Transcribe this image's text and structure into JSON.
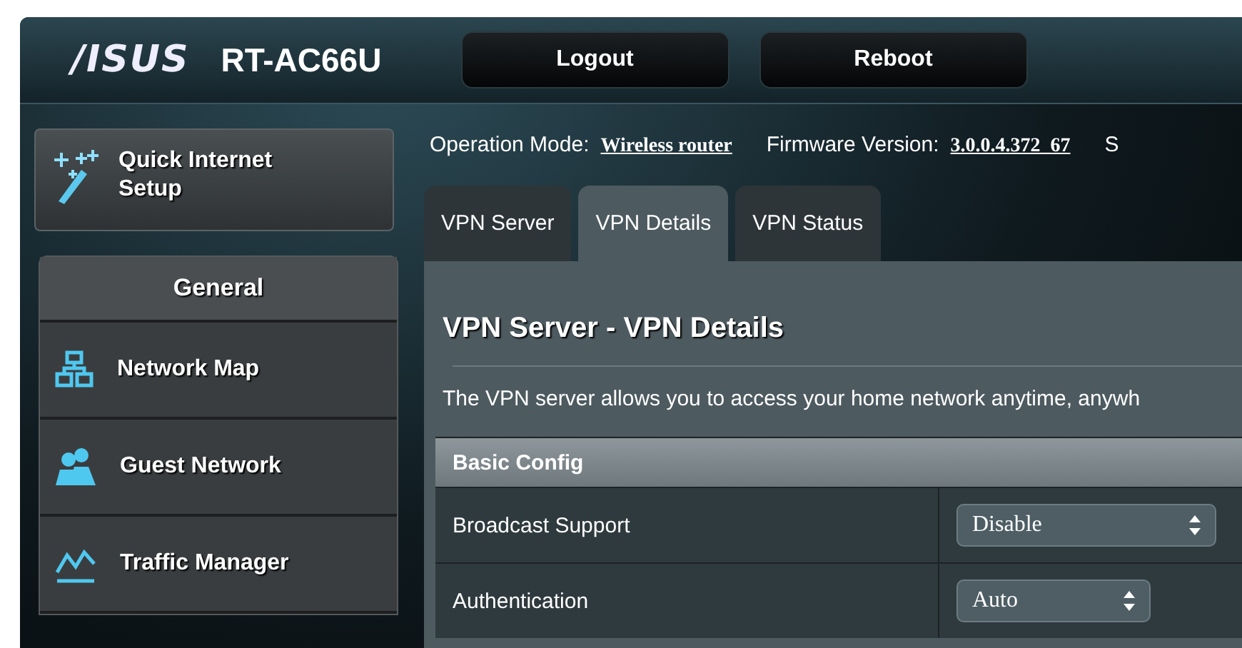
{
  "header": {
    "brand": "/ISUS",
    "model": "RT-AC66U",
    "buttons": [
      "Logout",
      "Reboot"
    ]
  },
  "quick_setup": {
    "label": "Quick Internet Setup"
  },
  "sidebar": {
    "title": "General",
    "items": [
      {
        "label": "Network Map"
      },
      {
        "label": "Guest Network"
      },
      {
        "label": "Traffic Manager"
      }
    ]
  },
  "status_line": [
    {
      "label": "Operation Mode:",
      "value": "Wireless router"
    },
    {
      "label": "Firmware Version:",
      "value": "3.0.0.4.372_67"
    },
    {
      "label": "S"
    }
  ],
  "tabs": [
    {
      "label": "VPN Server",
      "selected": false
    },
    {
      "label": "VPN Details",
      "selected": true
    },
    {
      "label": "VPN Status",
      "selected": false
    }
  ],
  "page": {
    "title": "VPN Server - VPN Details",
    "description": "The VPN server allows you to access your home network anytime, anywh"
  },
  "config": {
    "title": "Basic Config",
    "rows": [
      {
        "label": "Broadcast Support",
        "value": "Disable"
      },
      {
        "label": "Authentication",
        "value": "Auto"
      }
    ]
  }
}
